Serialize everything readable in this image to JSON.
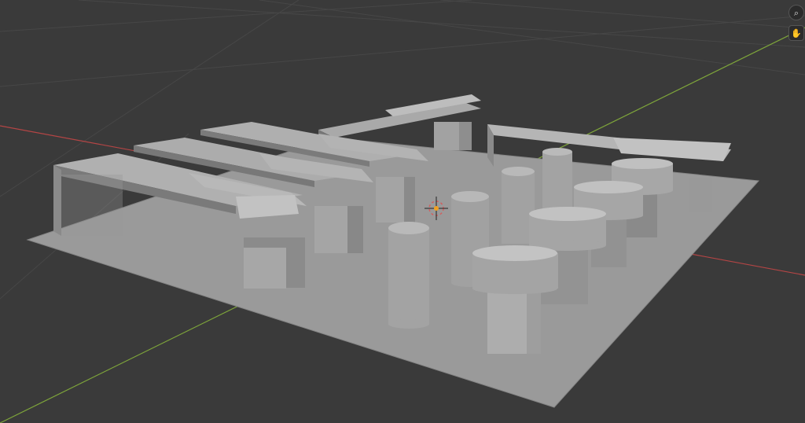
{
  "app": {
    "name": "3D viewport"
  },
  "colors": {
    "background": "#3a3a3a",
    "grid": "#444444",
    "x_axis": "#b44545",
    "y_axis": "#7ea53a",
    "plane": "#9a9a9a",
    "object_light": "#a8a8a8",
    "object_mid": "#8e8e8e",
    "object_dark": "#6a6a6a",
    "origin": "#f0a020"
  },
  "overlay": {
    "buttons": [
      {
        "icon": "search-icon",
        "glyph": "⌕"
      },
      {
        "icon": "hand-icon",
        "glyph": "✋"
      }
    ]
  }
}
